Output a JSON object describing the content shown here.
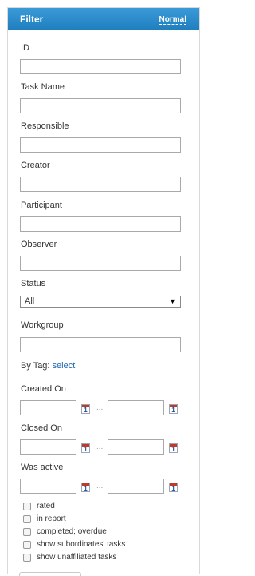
{
  "header": {
    "title": "Filter",
    "mode": "Normal"
  },
  "fields": {
    "id": "ID",
    "task_name": "Task Name",
    "responsible": "Responsible",
    "creator": "Creator",
    "participant": "Participant",
    "observer": "Observer",
    "status": "Status",
    "workgroup": "Workgroup"
  },
  "status_select": {
    "value": "All"
  },
  "tag": {
    "label": "By Tag:",
    "link": "select"
  },
  "dates": {
    "created_on": "Created On",
    "closed_on": "Closed On",
    "was_active": "Was active",
    "calendar_glyph": "1",
    "separator": "..."
  },
  "checkboxes": [
    {
      "label": "rated",
      "checked": false
    },
    {
      "label": "in report",
      "checked": false
    },
    {
      "label": "completed; overdue",
      "checked": false
    },
    {
      "label": "show subordinates' tasks",
      "checked": false
    },
    {
      "label": "show unaffiliated tasks",
      "checked": false
    }
  ]
}
